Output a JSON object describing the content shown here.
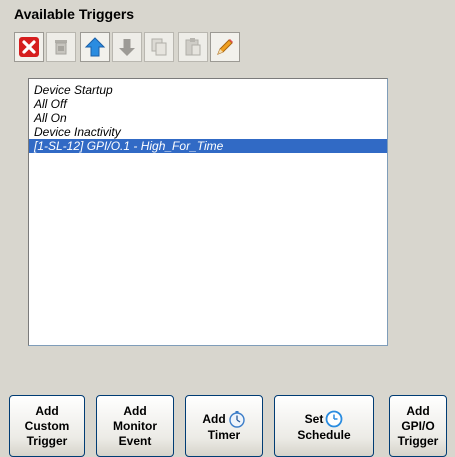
{
  "panel": {
    "title": "Available Triggers"
  },
  "toolbar": {
    "buttons": [
      {
        "icon": "delete-icon",
        "enabled": true
      },
      {
        "icon": "recycle-bin-icon",
        "enabled": false
      },
      {
        "icon": "move-up-icon",
        "enabled": true
      },
      {
        "icon": "move-down-icon",
        "enabled": false
      },
      {
        "icon": "copy-icon",
        "enabled": false
      },
      {
        "icon": "paste-icon",
        "enabled": false
      },
      {
        "icon": "edit-pencil-icon",
        "enabled": true
      }
    ]
  },
  "triggers": {
    "items": [
      "Device Startup",
      "All Off",
      "All On",
      "Device Inactivity",
      "[1-SL-12] GPI/O.1 - High_For_Time"
    ],
    "selected_index": 4
  },
  "bottom_buttons": {
    "custom": "Add\nCustom\nTrigger",
    "monitor": "Add\nMonitor\nEvent",
    "timer_line1": "Add",
    "timer_line2": "Timer",
    "schedule_line1": "Set",
    "schedule_line2": "Schedule",
    "gpio": "Add\nGPI/O\nTrigger"
  },
  "colors": {
    "selection": "#316ac5",
    "panel_bg": "#d8d6ce",
    "delete_red": "#d61e1e",
    "arrow_blue": "#2a8ce0",
    "pencil_orange": "#f0a020"
  }
}
